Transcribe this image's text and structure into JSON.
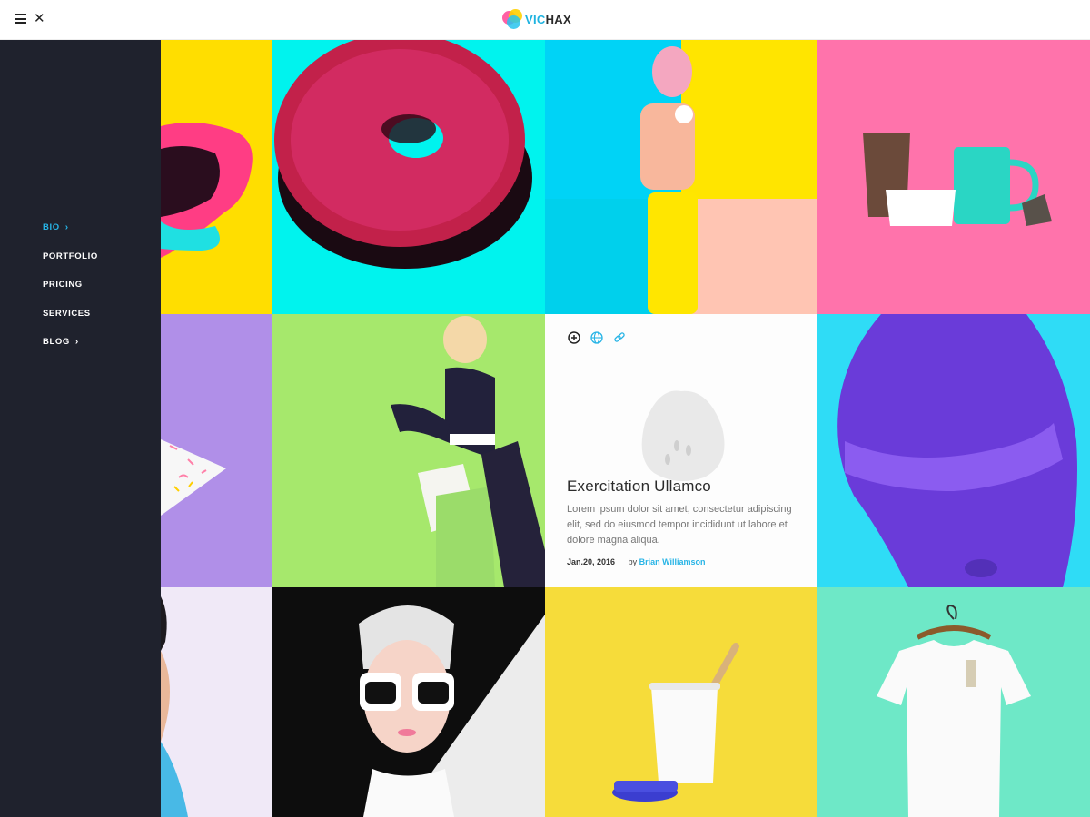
{
  "header": {
    "logo_prefix": "VIC",
    "logo_suffix": "HAX",
    "menu_icon": "hamburger-icon",
    "close_icon": "close-icon"
  },
  "sidebar": {
    "items": [
      {
        "label": "BIO",
        "active": true,
        "has_chevron": true
      },
      {
        "label": "PORTFOLIO",
        "active": false,
        "has_chevron": false
      },
      {
        "label": "PRICING",
        "active": false,
        "has_chevron": false
      },
      {
        "label": "SERVICES",
        "active": false,
        "has_chevron": false
      },
      {
        "label": "BLOG",
        "active": false,
        "has_chevron": true
      }
    ]
  },
  "post": {
    "title": "Exercitation Ullamco",
    "excerpt": "Lorem ipsum dolor sit amet, consectetur adipiscing elit, sed do eiusmod tempor incididunt ut labore et dolore magna aliqua.",
    "date": "Jan.20, 2016",
    "by_label": "by",
    "author": "Brian Williamson",
    "icons": [
      "plus-circle-icon",
      "globe-icon",
      "link-icon"
    ]
  },
  "colors": {
    "accent": "#27b4e6",
    "sidebar_bg": "#1f222d",
    "yellow": "#ffe000",
    "cyan": "#00f0ec",
    "pink": "#ff6fa8",
    "lavender": "#b091e6",
    "lime": "#a3e86c",
    "blue": "#2ddcf5",
    "mint": "#6ee8c7"
  }
}
